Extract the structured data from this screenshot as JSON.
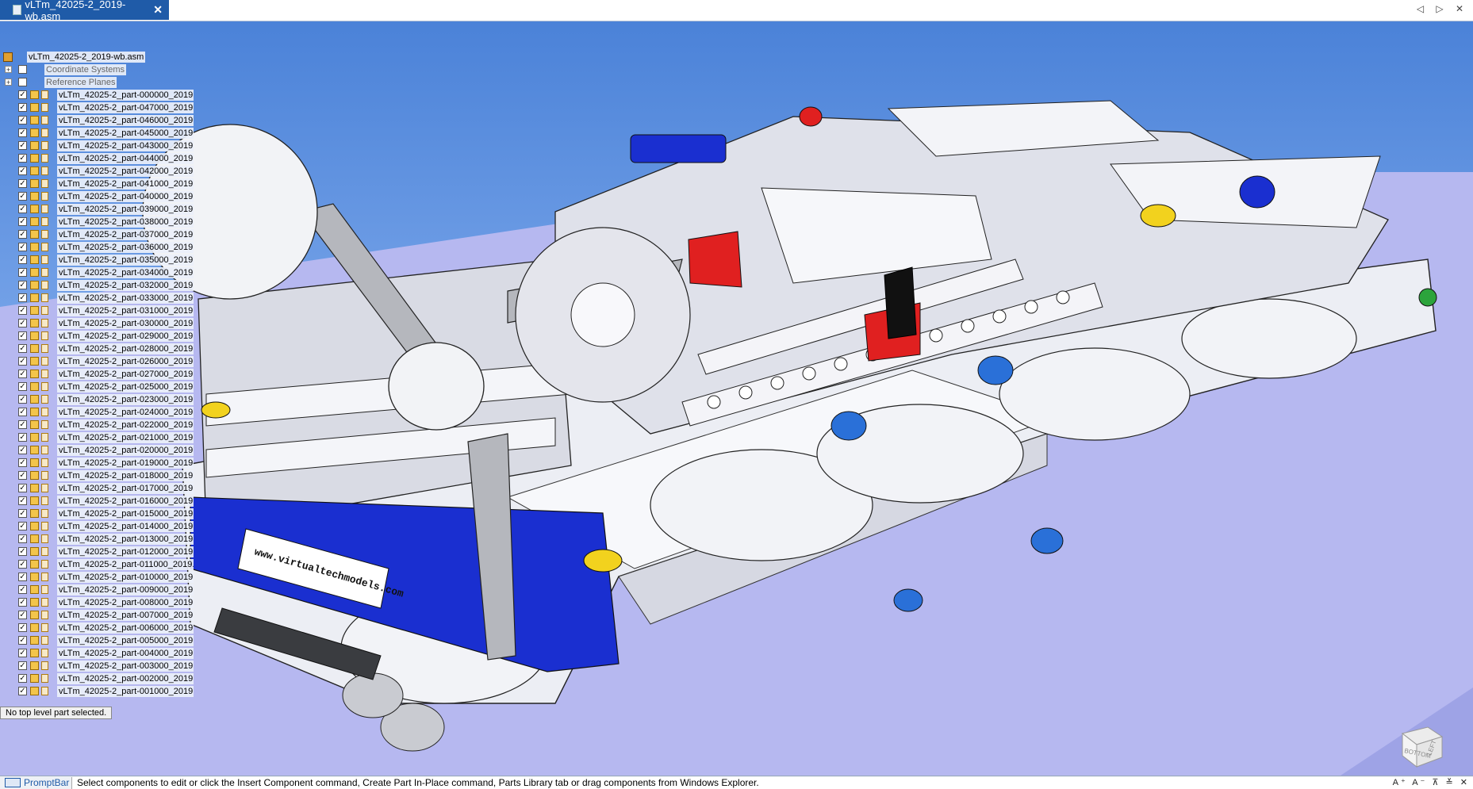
{
  "tab": {
    "title": "vLTm_42025-2_2019-wb.asm",
    "close": "✕"
  },
  "window_controls": "◁ ▷ ✕",
  "tree": {
    "root": "vLTm_42025-2_2019-wb.asm",
    "coordinate_systems": "Coordinate Systems",
    "reference_planes": "Reference Planes",
    "parts": [
      "vLTm_42025-2_part-000000_2019.",
      "vLTm_42025-2_part-047000_2019.",
      "vLTm_42025-2_part-046000_2019.",
      "vLTm_42025-2_part-045000_2019.",
      "vLTm_42025-2_part-043000_2019.",
      "vLTm_42025-2_part-044000_2019.",
      "vLTm_42025-2_part-042000_2019.",
      "vLTm_42025-2_part-041000_2019.",
      "vLTm_42025-2_part-040000_2019.",
      "vLTm_42025-2_part-039000_2019.",
      "vLTm_42025-2_part-038000_2019.",
      "vLTm_42025-2_part-037000_2019.",
      "vLTm_42025-2_part-036000_2019.",
      "vLTm_42025-2_part-035000_2019.",
      "vLTm_42025-2_part-034000_2019.",
      "vLTm_42025-2_part-032000_2019.",
      "vLTm_42025-2_part-033000_2019.",
      "vLTm_42025-2_part-031000_2019.",
      "vLTm_42025-2_part-030000_2019.",
      "vLTm_42025-2_part-029000_2019.",
      "vLTm_42025-2_part-028000_2019.",
      "vLTm_42025-2_part-026000_2019.",
      "vLTm_42025-2_part-027000_2019.",
      "vLTm_42025-2_part-025000_2019.",
      "vLTm_42025-2_part-023000_2019.",
      "vLTm_42025-2_part-024000_2019.",
      "vLTm_42025-2_part-022000_2019.",
      "vLTm_42025-2_part-021000_2019.",
      "vLTm_42025-2_part-020000_2019.",
      "vLTm_42025-2_part-019000_2019.",
      "vLTm_42025-2_part-018000_2019.",
      "vLTm_42025-2_part-017000_2019.",
      "vLTm_42025-2_part-016000_2019.",
      "vLTm_42025-2_part-015000_2019.",
      "vLTm_42025-2_part-014000_2019.",
      "vLTm_42025-2_part-013000_2019.",
      "vLTm_42025-2_part-012000_2019.",
      "vLTm_42025-2_part-011000_2019.",
      "vLTm_42025-2_part-010000_2019.",
      "vLTm_42025-2_part-009000_2019.",
      "vLTm_42025-2_part-008000_2019.",
      "vLTm_42025-2_part-007000_2019.",
      "vLTm_42025-2_part-006000_2019.",
      "vLTm_42025-2_part-005000_2019.",
      "vLTm_42025-2_part-004000_2019.",
      "vLTm_42025-2_part-003000_2019.",
      "vLTm_42025-2_part-002000_2019.",
      "vLTm_42025-2_part-001000_2019."
    ]
  },
  "status_note": "No top level part selected.",
  "model_label": "www.virtualtechmodels.com",
  "navcube": {
    "face_bottom": "BOTTOM",
    "face_left": "LEFT"
  },
  "promptbar": {
    "title": "PromptBar",
    "message": "Select components to edit or click the Insert Component command, Create Part In-Place command, Parts Library tab or drag components from Windows Explorer.",
    "tools": "A⁺ A⁻ ⊼ ≚ ✕"
  },
  "colors": {
    "accent": "#1f5ba8",
    "floor": "#b3b8f2",
    "sky": "#4b82d8",
    "lego_blue": "#1a2fd0",
    "lego_red": "#e02020",
    "lego_yellow": "#f2d21e"
  }
}
